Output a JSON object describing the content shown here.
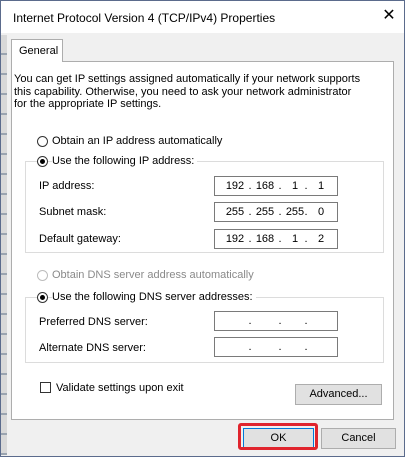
{
  "window": {
    "title": "Internet Protocol Version 4 (TCP/IPv4) Properties",
    "close_glyph": "✕"
  },
  "tabs": [
    {
      "label": "General",
      "selected": true
    }
  ],
  "intro_lines": [
    "You can get IP settings assigned automatically if your network supports",
    "this capability. Otherwise, you need to ask your network administrator",
    "for the appropriate IP settings."
  ],
  "ip_mode": {
    "auto_label": "Obtain an IP address automatically",
    "manual_label": "Use the following IP address:",
    "selected": "manual"
  },
  "ip_fields": [
    {
      "label": "IP address:",
      "octets": [
        "192",
        "168",
        "1",
        "1"
      ]
    },
    {
      "label": "Subnet mask:",
      "octets": [
        "255",
        "255",
        "255",
        "0"
      ]
    },
    {
      "label": "Default gateway:",
      "octets": [
        "192",
        "168",
        "1",
        "2"
      ]
    }
  ],
  "dns_mode": {
    "auto_label": "Obtain DNS server address automatically",
    "auto_enabled": false,
    "manual_label": "Use the following DNS server addresses:",
    "selected": "manual"
  },
  "dns_fields": [
    {
      "label": "Preferred DNS server:",
      "octets": [
        "",
        "",
        "",
        ""
      ]
    },
    {
      "label": "Alternate DNS server:",
      "octets": [
        "",
        "",
        "",
        ""
      ]
    }
  ],
  "validate": {
    "label": "Validate settings upon exit",
    "checked": false
  },
  "buttons": {
    "advanced": "Advanced...",
    "ok": "OK",
    "cancel": "Cancel"
  },
  "colors": {
    "highlight": "#e0242d",
    "window_border": "#5b6b8c"
  },
  "octet_separator": "."
}
